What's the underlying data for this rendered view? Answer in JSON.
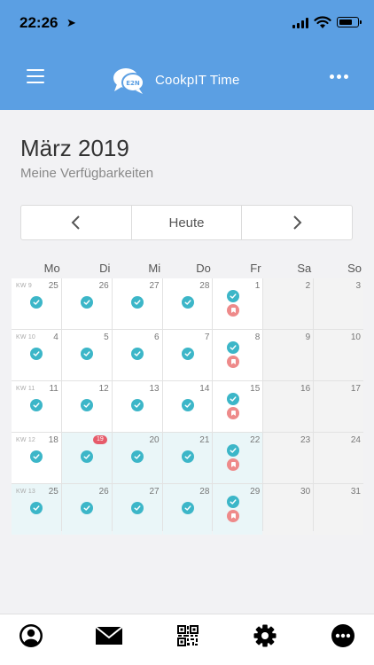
{
  "status": {
    "time": "22:26"
  },
  "header": {
    "title": "CookpIT Time",
    "logo_text": "E2N"
  },
  "calendar": {
    "month_title": "März 2019",
    "subtitle": "Meine Verfügbarkeiten",
    "today_label": "Heute",
    "weekdays": [
      "Mo",
      "Di",
      "Mi",
      "Do",
      "Fr",
      "Sa",
      "So"
    ],
    "weeks": [
      {
        "kw": "KW 9",
        "days": [
          "25",
          "26",
          "27",
          "28",
          "1",
          "2",
          "3"
        ]
      },
      {
        "kw": "KW 10",
        "days": [
          "4",
          "5",
          "6",
          "7",
          "8",
          "9",
          "10"
        ]
      },
      {
        "kw": "KW 11",
        "days": [
          "11",
          "12",
          "13",
          "14",
          "15",
          "16",
          "17"
        ]
      },
      {
        "kw": "KW 12",
        "days": [
          "18",
          "19",
          "20",
          "21",
          "22",
          "23",
          "24"
        ]
      },
      {
        "kw": "KW 13",
        "days": [
          "25",
          "26",
          "27",
          "28",
          "29",
          "30",
          "31"
        ]
      }
    ],
    "today_badge": "19"
  },
  "colors": {
    "primary": "#5b9fe3",
    "available": "#3cb6c8",
    "marked": "#ee8a8a",
    "badge": "#e65b6a"
  },
  "tabs": [
    {
      "name": "profile",
      "icon": "user-circle-icon"
    },
    {
      "name": "messages",
      "icon": "envelope-icon"
    },
    {
      "name": "scan",
      "icon": "qr-code-icon"
    },
    {
      "name": "settings",
      "icon": "gear-icon"
    },
    {
      "name": "more",
      "icon": "more-circle-icon"
    }
  ]
}
